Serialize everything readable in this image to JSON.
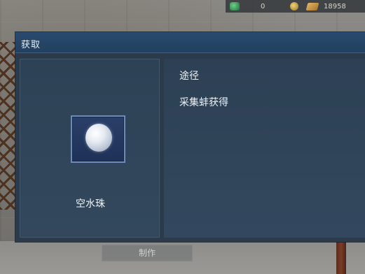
{
  "currency": {
    "gem_icon": "green-gem-icon",
    "gem_value": "0",
    "coin_icon": "gold-coin-icon",
    "ticket_icon": "ticket-icon",
    "ticket_value": "18958"
  },
  "dialog": {
    "title": "获取",
    "item": {
      "icon": "pearl-icon",
      "name": "空水珠"
    },
    "source": {
      "heading": "途径",
      "items": [
        "采集蚌获得"
      ]
    }
  },
  "footer": {
    "make_label": "制作"
  }
}
